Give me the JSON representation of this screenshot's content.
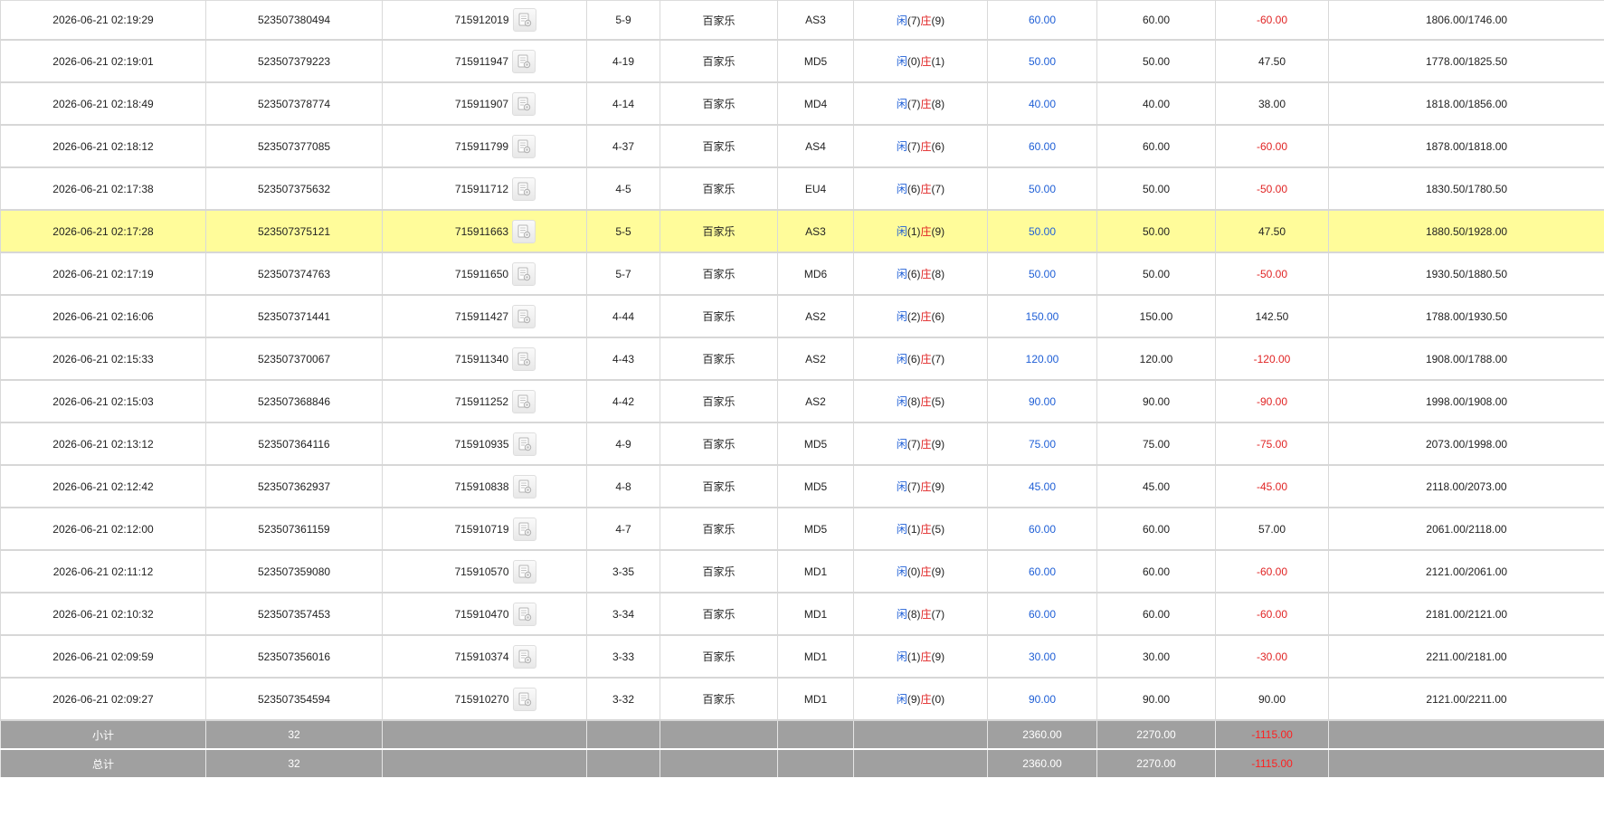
{
  "rows": [
    {
      "time": "2026-06-21 02:19:29",
      "bet_no": "523507380494",
      "order_id": "715912019",
      "round": "5-9",
      "game": "百家乐",
      "table": "AS3",
      "xian": "(7)",
      "zhuang": "(9)",
      "bet": "60.00",
      "valid": "60.00",
      "win": "-60.00",
      "win_neg": true,
      "balance": "1806.00/1746.00"
    },
    {
      "time": "2026-06-21 02:19:01",
      "bet_no": "523507379223",
      "order_id": "715911947",
      "round": "4-19",
      "game": "百家乐",
      "table": "MD5",
      "xian": "(0)",
      "zhuang": "(1)",
      "bet": "50.00",
      "valid": "50.00",
      "win": "47.50",
      "win_neg": false,
      "balance": "1778.00/1825.50"
    },
    {
      "time": "2026-06-21 02:18:49",
      "bet_no": "523507378774",
      "order_id": "715911907",
      "round": "4-14",
      "game": "百家乐",
      "table": "MD4",
      "xian": "(7)",
      "zhuang": "(8)",
      "bet": "40.00",
      "valid": "40.00",
      "win": "38.00",
      "win_neg": false,
      "balance": "1818.00/1856.00"
    },
    {
      "time": "2026-06-21 02:18:12",
      "bet_no": "523507377085",
      "order_id": "715911799",
      "round": "4-37",
      "game": "百家乐",
      "table": "AS4",
      "xian": "(7)",
      "zhuang": "(6)",
      "bet": "60.00",
      "valid": "60.00",
      "win": "-60.00",
      "win_neg": true,
      "balance": "1878.00/1818.00"
    },
    {
      "time": "2026-06-21 02:17:38",
      "bet_no": "523507375632",
      "order_id": "715911712",
      "round": "4-5",
      "game": "百家乐",
      "table": "EU4",
      "xian": "(6)",
      "zhuang": "(7)",
      "bet": "50.00",
      "valid": "50.00",
      "win": "-50.00",
      "win_neg": true,
      "balance": "1830.50/1780.50"
    },
    {
      "time": "2026-06-21 02:17:28",
      "bet_no": "523507375121",
      "order_id": "715911663",
      "round": "5-5",
      "game": "百家乐",
      "table": "AS3",
      "xian": "(1)",
      "zhuang": "(9)",
      "bet": "50.00",
      "valid": "50.00",
      "win": "47.50",
      "win_neg": false,
      "balance": "1880.50/1928.00",
      "highlight": true
    },
    {
      "time": "2026-06-21 02:17:19",
      "bet_no": "523507374763",
      "order_id": "715911650",
      "round": "5-7",
      "game": "百家乐",
      "table": "MD6",
      "xian": "(6)",
      "zhuang": "(8)",
      "bet": "50.00",
      "valid": "50.00",
      "win": "-50.00",
      "win_neg": true,
      "balance": "1930.50/1880.50"
    },
    {
      "time": "2026-06-21 02:16:06",
      "bet_no": "523507371441",
      "order_id": "715911427",
      "round": "4-44",
      "game": "百家乐",
      "table": "AS2",
      "xian": "(2)",
      "zhuang": "(6)",
      "bet": "150.00",
      "valid": "150.00",
      "win": "142.50",
      "win_neg": false,
      "balance": "1788.00/1930.50"
    },
    {
      "time": "2026-06-21 02:15:33",
      "bet_no": "523507370067",
      "order_id": "715911340",
      "round": "4-43",
      "game": "百家乐",
      "table": "AS2",
      "xian": "(6)",
      "zhuang": "(7)",
      "bet": "120.00",
      "valid": "120.00",
      "win": "-120.00",
      "win_neg": true,
      "balance": "1908.00/1788.00"
    },
    {
      "time": "2026-06-21 02:15:03",
      "bet_no": "523507368846",
      "order_id": "715911252",
      "round": "4-42",
      "game": "百家乐",
      "table": "AS2",
      "xian": "(8)",
      "zhuang": "(5)",
      "bet": "90.00",
      "valid": "90.00",
      "win": "-90.00",
      "win_neg": true,
      "balance": "1998.00/1908.00"
    },
    {
      "time": "2026-06-21 02:13:12",
      "bet_no": "523507364116",
      "order_id": "715910935",
      "round": "4-9",
      "game": "百家乐",
      "table": "MD5",
      "xian": "(7)",
      "zhuang": "(9)",
      "bet": "75.00",
      "valid": "75.00",
      "win": "-75.00",
      "win_neg": true,
      "balance": "2073.00/1998.00"
    },
    {
      "time": "2026-06-21 02:12:42",
      "bet_no": "523507362937",
      "order_id": "715910838",
      "round": "4-8",
      "game": "百家乐",
      "table": "MD5",
      "xian": "(7)",
      "zhuang": "(9)",
      "bet": "45.00",
      "valid": "45.00",
      "win": "-45.00",
      "win_neg": true,
      "balance": "2118.00/2073.00"
    },
    {
      "time": "2026-06-21 02:12:00",
      "bet_no": "523507361159",
      "order_id": "715910719",
      "round": "4-7",
      "game": "百家乐",
      "table": "MD5",
      "xian": "(1)",
      "zhuang": "(5)",
      "bet": "60.00",
      "valid": "60.00",
      "win": "57.00",
      "win_neg": false,
      "balance": "2061.00/2118.00"
    },
    {
      "time": "2026-06-21 02:11:12",
      "bet_no": "523507359080",
      "order_id": "715910570",
      "round": "3-35",
      "game": "百家乐",
      "table": "MD1",
      "xian": "(0)",
      "zhuang": "(9)",
      "bet": "60.00",
      "valid": "60.00",
      "win": "-60.00",
      "win_neg": true,
      "balance": "2121.00/2061.00"
    },
    {
      "time": "2026-06-21 02:10:32",
      "bet_no": "523507357453",
      "order_id": "715910470",
      "round": "3-34",
      "game": "百家乐",
      "table": "MD1",
      "xian": "(8)",
      "zhuang": "(7)",
      "bet": "60.00",
      "valid": "60.00",
      "win": "-60.00",
      "win_neg": true,
      "balance": "2181.00/2121.00"
    },
    {
      "time": "2026-06-21 02:09:59",
      "bet_no": "523507356016",
      "order_id": "715910374",
      "round": "3-33",
      "game": "百家乐",
      "table": "MD1",
      "xian": "(1)",
      "zhuang": "(9)",
      "bet": "30.00",
      "valid": "30.00",
      "win": "-30.00",
      "win_neg": true,
      "balance": "2211.00/2181.00"
    },
    {
      "time": "2026-06-21 02:09:27",
      "bet_no": "523507354594",
      "order_id": "715910270",
      "round": "3-32",
      "game": "百家乐",
      "table": "MD1",
      "xian": "(9)",
      "zhuang": "(0)",
      "bet": "90.00",
      "valid": "90.00",
      "win": "90.00",
      "win_neg": false,
      "balance": "2121.00/2211.00"
    }
  ],
  "labels": {
    "xian": "闲",
    "zhuang": "庄"
  },
  "detail_icon": "receipt-detail-icon",
  "subtotal": {
    "label": "小计",
    "count": "32",
    "bet": "2360.00",
    "valid": "2270.00",
    "win": "-1115.00"
  },
  "total": {
    "label": "总计",
    "count": "32",
    "bet": "2360.00",
    "valid": "2270.00",
    "win": "-1115.00"
  },
  "colors": {
    "highlight": "#fffc9a",
    "positive_blue": "#1f5fd6",
    "negative_red": "#e02424",
    "total_bg": "#a0a0a0"
  }
}
